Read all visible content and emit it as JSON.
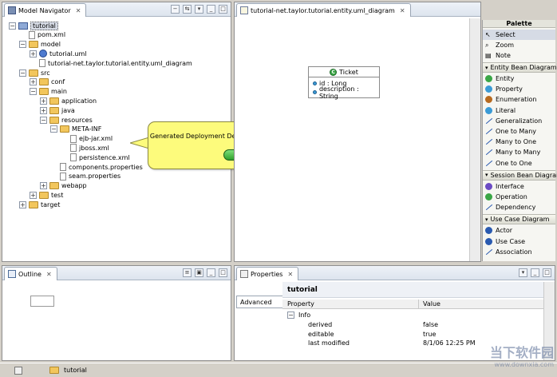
{
  "navigator": {
    "title": "Model Navigator",
    "items": [
      {
        "label": "tutorial",
        "kind": "project",
        "depth": 0,
        "toggle": "-",
        "selected": true
      },
      {
        "label": "pom.xml",
        "kind": "file",
        "depth": 1,
        "toggle": ""
      },
      {
        "label": "model",
        "kind": "folder",
        "depth": 1,
        "toggle": "-"
      },
      {
        "label": "tutorial.uml",
        "kind": "uml",
        "depth": 2,
        "toggle": "+"
      },
      {
        "label": "tutorial-net.taylor.tutorial.entity.uml_diagram",
        "kind": "file",
        "depth": 2,
        "toggle": ""
      },
      {
        "label": "src",
        "kind": "folder",
        "depth": 1,
        "toggle": "-"
      },
      {
        "label": "conf",
        "kind": "folder",
        "depth": 2,
        "toggle": "+"
      },
      {
        "label": "main",
        "kind": "folder",
        "depth": 2,
        "toggle": "-"
      },
      {
        "label": "application",
        "kind": "folder",
        "depth": 3,
        "toggle": "+"
      },
      {
        "label": "java",
        "kind": "folder",
        "depth": 3,
        "toggle": "+"
      },
      {
        "label": "resources",
        "kind": "folder",
        "depth": 3,
        "toggle": "-"
      },
      {
        "label": "META-INF",
        "kind": "folder",
        "depth": 4,
        "toggle": "-"
      },
      {
        "label": "ejb-jar.xml",
        "kind": "file",
        "depth": 5,
        "toggle": ""
      },
      {
        "label": "jboss.xml",
        "kind": "file",
        "depth": 5,
        "toggle": ""
      },
      {
        "label": "persistence.xml",
        "kind": "file",
        "depth": 5,
        "toggle": ""
      },
      {
        "label": "components.properties",
        "kind": "file",
        "depth": 4,
        "toggle": ""
      },
      {
        "label": "seam.properties",
        "kind": "file",
        "depth": 4,
        "toggle": ""
      },
      {
        "label": "webapp",
        "kind": "folder",
        "depth": 3,
        "toggle": "+"
      },
      {
        "label": "test",
        "kind": "folder",
        "depth": 2,
        "toggle": "+"
      },
      {
        "label": "target",
        "kind": "folder",
        "depth": 1,
        "toggle": "+"
      }
    ]
  },
  "callout": {
    "text": "Generated Deployment Descriptors",
    "button_glyph": "➡"
  },
  "editor": {
    "tab_title": "tutorial-net.taylor.tutorial.entity.uml_diagram",
    "class": {
      "name": "Ticket",
      "attributes": [
        "id : Long",
        "description : String"
      ]
    }
  },
  "palette": {
    "title": "Palette",
    "tools": [
      "Select",
      "Zoom",
      "Note"
    ],
    "drawers": [
      {
        "name": "Entity Bean Diagram",
        "items": [
          "Entity",
          "Property",
          "Enumeration",
          "Literal",
          "Generalization",
          "One to Many",
          "Many to One",
          "Many to Many",
          "One to One"
        ]
      },
      {
        "name": "Session Bean Diagram",
        "items": [
          "Interface",
          "Operation",
          "Dependency"
        ]
      },
      {
        "name": "Use Case Diagram",
        "items": [
          "Actor",
          "Use Case",
          "Association"
        ]
      }
    ]
  },
  "outline": {
    "title": "Outline"
  },
  "properties": {
    "title": "Properties",
    "tab": "Advanced",
    "object": "tutorial",
    "col_property": "Property",
    "col_value": "Value",
    "group": "Info",
    "rows": [
      {
        "name": "derived",
        "value": "false"
      },
      {
        "name": "editable",
        "value": "true"
      },
      {
        "name": "last modified",
        "value": "8/1/06 12:25 PM"
      }
    ]
  },
  "statusbar": {
    "label": "tutorial"
  },
  "watermark": {
    "line1": "当下软件园",
    "line2": "www.downxia.com"
  },
  "colors": {
    "callout": "#fdfb7c",
    "accent": "#2fa12b",
    "selection": "#d6dbe5"
  }
}
